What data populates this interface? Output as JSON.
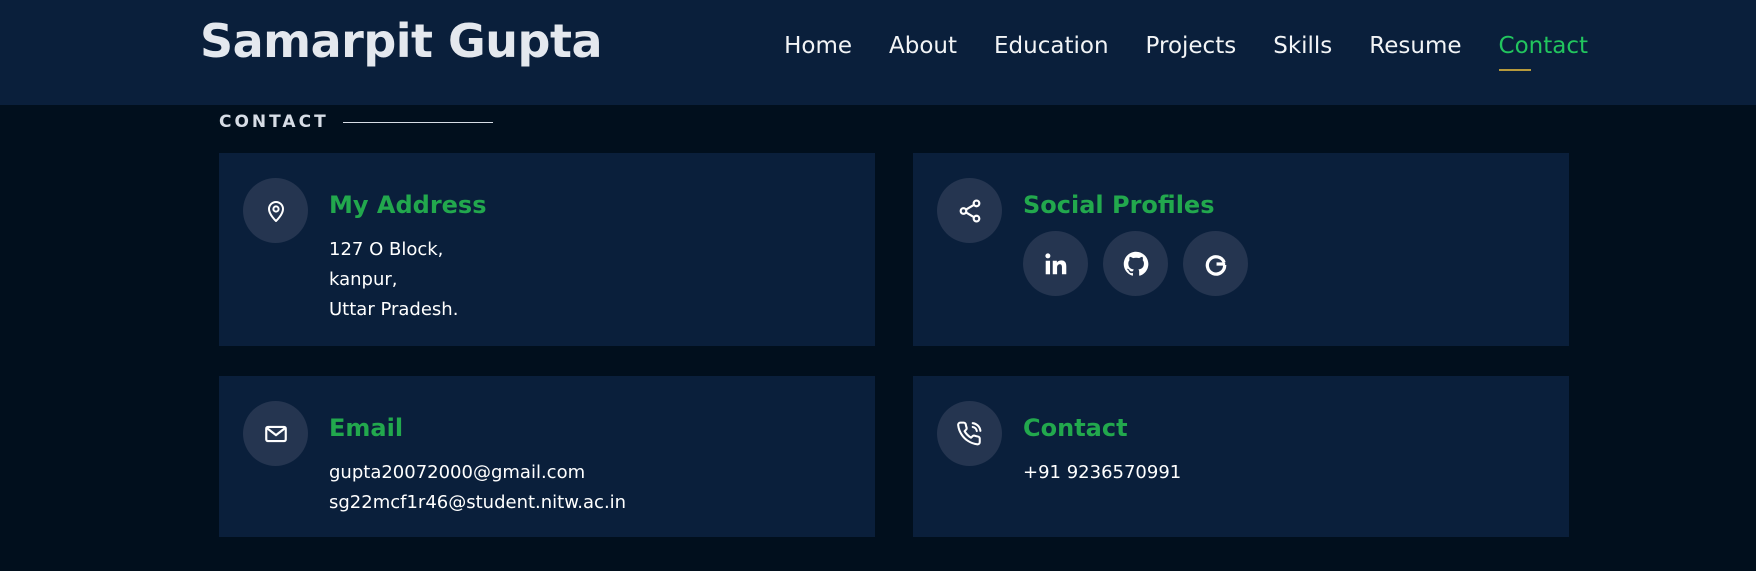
{
  "brand": "Samarpit Gupta",
  "nav": [
    "Home",
    "About",
    "Education",
    "Projects",
    "Skills",
    "Resume",
    "Contact"
  ],
  "active_nav": "Contact",
  "section_label": "CONTACT",
  "colors": {
    "accent": "#22a84d",
    "active_link": "#22c55e",
    "card_bg": "#0a1f3b",
    "page_bg": "#010f1d"
  },
  "cards": {
    "address": {
      "title": "My Address",
      "lines": [
        "127 O Block,",
        "kanpur,",
        "Uttar Pradesh."
      ],
      "icon": "map-pin-icon"
    },
    "social": {
      "title": "Social Profiles",
      "icon": "share-icon",
      "profiles": [
        "linkedin-icon",
        "github-icon",
        "google-icon"
      ]
    },
    "email": {
      "title": "Email",
      "lines": [
        "gupta20072000@gmail.com",
        "sg22mcf1r46@student.nitw.ac.in"
      ],
      "icon": "mail-icon"
    },
    "contact": {
      "title": "Contact",
      "lines": [
        "+91 9236570991"
      ],
      "icon": "phone-icon"
    }
  }
}
